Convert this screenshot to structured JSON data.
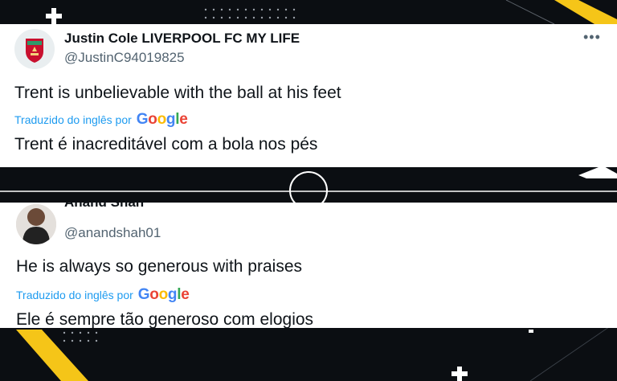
{
  "tweets": [
    {
      "name": "Justin Cole LIVERPOOL FC MY LIFE",
      "handle": "@JustinC94019825",
      "more": "•••",
      "text": "Trent is unbelievable with the ball at his feet",
      "translated_label": "Traduzido do inglês por",
      "translation": "Trent é inacreditável com a bola nos pés",
      "avatar_icon": "liverpool-crest-icon"
    },
    {
      "name": "Anand Shah",
      "handle": "@anandshah01",
      "text": "He is always so generous with praises",
      "translated_label": "Traduzido do inglês por",
      "translation": "Ele é sempre tão generoso com elogios",
      "avatar_icon": "profile-photo"
    }
  ],
  "google_logo": [
    "G",
    "o",
    "o",
    "g",
    "l",
    "e"
  ],
  "colors": {
    "background": "#0b0e12",
    "accent_yellow": "#f5c518",
    "link_blue": "#1d9bf0",
    "liverpool_red": "#c8102e"
  }
}
